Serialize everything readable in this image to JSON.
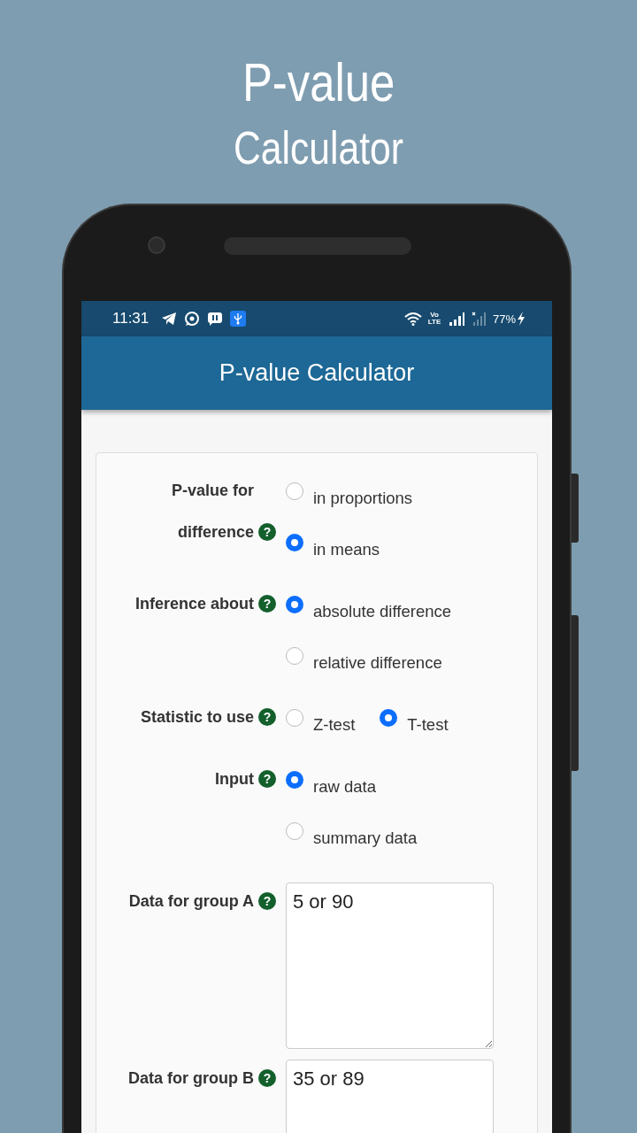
{
  "promo": {
    "title": "P-value",
    "subtitle": "Calculator"
  },
  "status_bar": {
    "time": "11:31",
    "network_label": "Vo LTE",
    "battery": "77%"
  },
  "app_bar": {
    "title": "P-value Calculator"
  },
  "form": {
    "rows": [
      {
        "kind": "radio",
        "label": "P-value for difference",
        "help": "?",
        "options": [
          {
            "label": "in proportions",
            "selected": false
          },
          {
            "label": "in means",
            "selected": true
          }
        ]
      },
      {
        "kind": "radio",
        "label": "Inference about",
        "help": "?",
        "options": [
          {
            "label": "absolute difference",
            "selected": true
          },
          {
            "label": "relative difference",
            "selected": false
          }
        ]
      },
      {
        "kind": "radio-inline",
        "label": "Statistic to use",
        "help": "?",
        "options": [
          {
            "label": "Z-test",
            "selected": false
          },
          {
            "label": "T-test",
            "selected": true
          }
        ]
      },
      {
        "kind": "radio",
        "label": "Input",
        "help": "?",
        "options": [
          {
            "label": "raw data",
            "selected": true
          },
          {
            "label": "summary data",
            "selected": false
          }
        ]
      },
      {
        "kind": "textarea",
        "label": "Data for group A",
        "help": "?",
        "value": "5 or 90"
      },
      {
        "kind": "textarea",
        "label": "Data for group B",
        "help": "?",
        "value": "35 or 89"
      }
    ]
  }
}
